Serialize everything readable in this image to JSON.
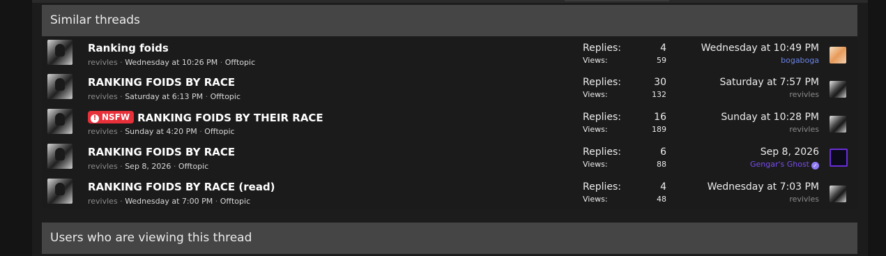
{
  "similar": {
    "header": "Similar threads",
    "threads": [
      {
        "title": "Ranking foids",
        "nsfw": false,
        "author": "revivles",
        "date": "Wednesday at 10:26 PM",
        "forum": "Offtopic",
        "replies_label": "Replies:",
        "replies": "4",
        "views_label": "Views:",
        "views": "59",
        "last_date": "Wednesday at 10:49 PM",
        "last_user": "bogaboga",
        "last_user_color": "#6a84e8"
      },
      {
        "title": "RANKING FOIDS BY RACE",
        "nsfw": false,
        "author": "revivles",
        "date": "Saturday at 6:13 PM",
        "forum": "Offtopic",
        "replies_label": "Replies:",
        "replies": "30",
        "views_label": "Views:",
        "views": "132",
        "last_date": "Saturday at 7:57 PM",
        "last_user": "revivles",
        "last_user_color": "#8c8c8c"
      },
      {
        "title": "RANKING FOIDS BY THEIR RACE",
        "nsfw": true,
        "nsfw_label": "NSFW",
        "author": "revivles",
        "date": "Sunday at 4:20 PM",
        "forum": "Offtopic",
        "replies_label": "Replies:",
        "replies": "16",
        "views_label": "Views:",
        "views": "189",
        "last_date": "Sunday at 10:28 PM",
        "last_user": "revivles",
        "last_user_color": "#8c8c8c"
      },
      {
        "title": "RANKING FOIDS BY RACE",
        "nsfw": false,
        "author": "revivles",
        "date": "Sep 8, 2026",
        "forum": "Offtopic",
        "replies_label": "Replies:",
        "replies": "6",
        "views_label": "Views:",
        "views": "88",
        "last_date": "Sep 8, 2026",
        "last_user": "Gengar's Ghost",
        "last_user_color": "#7a4cf0",
        "last_user_verified": true
      },
      {
        "title": "RANKING FOIDS BY RACE (read)",
        "nsfw": false,
        "author": "revivles",
        "date": "Wednesday at 7:00 PM",
        "forum": "Offtopic",
        "replies_label": "Replies:",
        "replies": "4",
        "views_label": "Views:",
        "views": "48",
        "last_date": "Wednesday at 7:03 PM",
        "last_user": "revivles",
        "last_user_color": "#8c8c8c"
      }
    ]
  },
  "viewing": {
    "header": "Users who are viewing this thread"
  },
  "icons": {
    "nsfw": "exclamation-circle-icon",
    "verified": "check-badge-icon"
  }
}
